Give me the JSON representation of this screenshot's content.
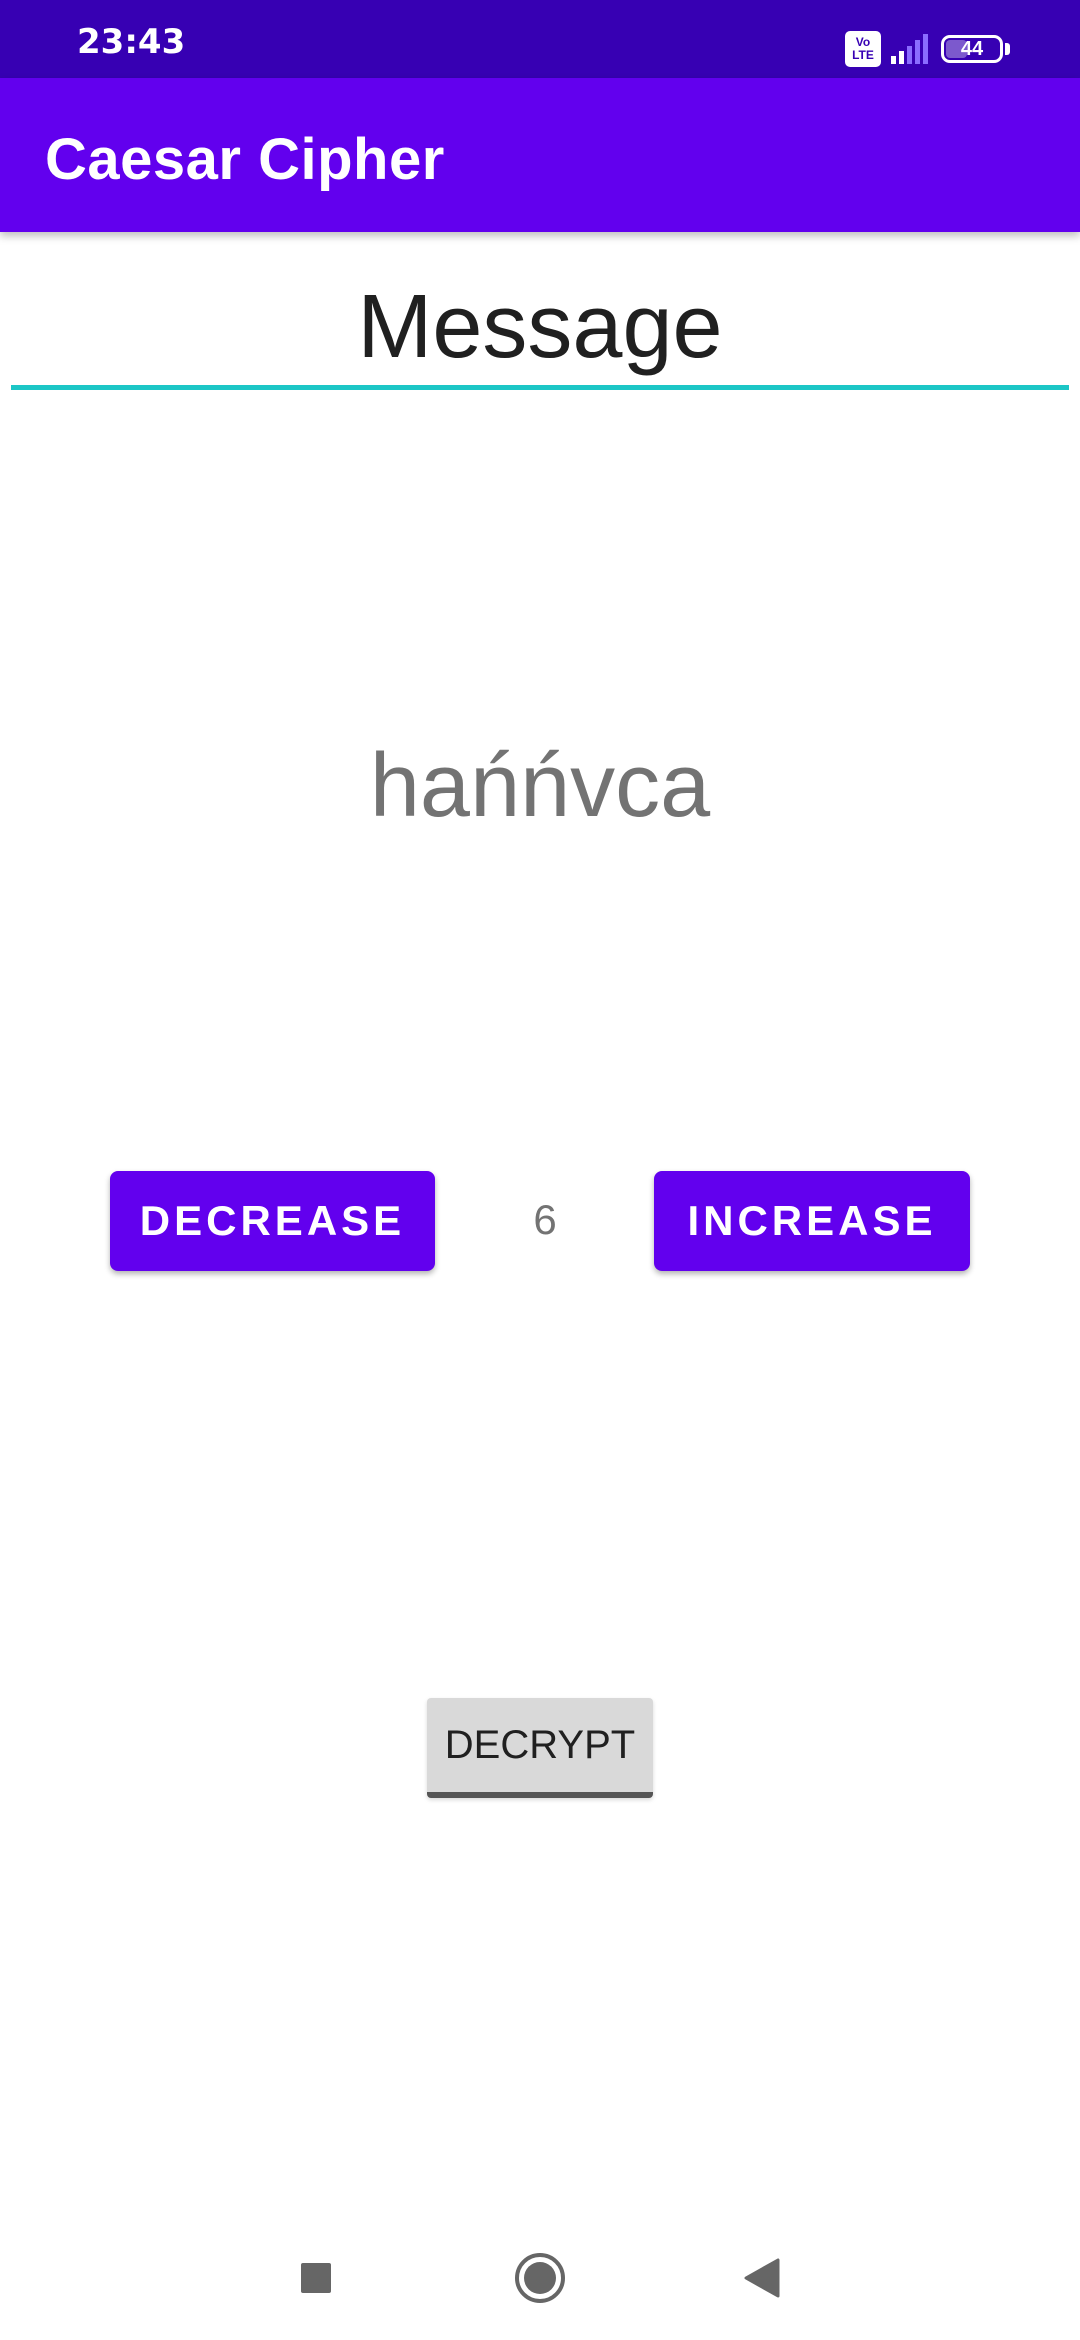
{
  "status_bar": {
    "time": "23:43",
    "volte_line1": "Vo",
    "volte_line2": "LTE",
    "battery_level": "44"
  },
  "app_bar": {
    "title": "Caesar Cipher"
  },
  "message_field": {
    "placeholder": "Message",
    "value": ""
  },
  "result_text": "hańńvca",
  "shift_controls": {
    "decrease_label": "DECREASE",
    "value": "6",
    "increase_label": "INCREASE"
  },
  "decrypt_label": "DECRYPT",
  "nav_bar": {
    "recents_icon": "square-icon",
    "home_icon": "circle-icon",
    "back_icon": "triangle-back-icon"
  },
  "colors": {
    "status_bar": "#3700b3",
    "app_bar": "#6200ee",
    "accent_underline": "#1cc6c6",
    "primary_button": "#6200ee",
    "secondary_button": "#d9d9d9"
  }
}
